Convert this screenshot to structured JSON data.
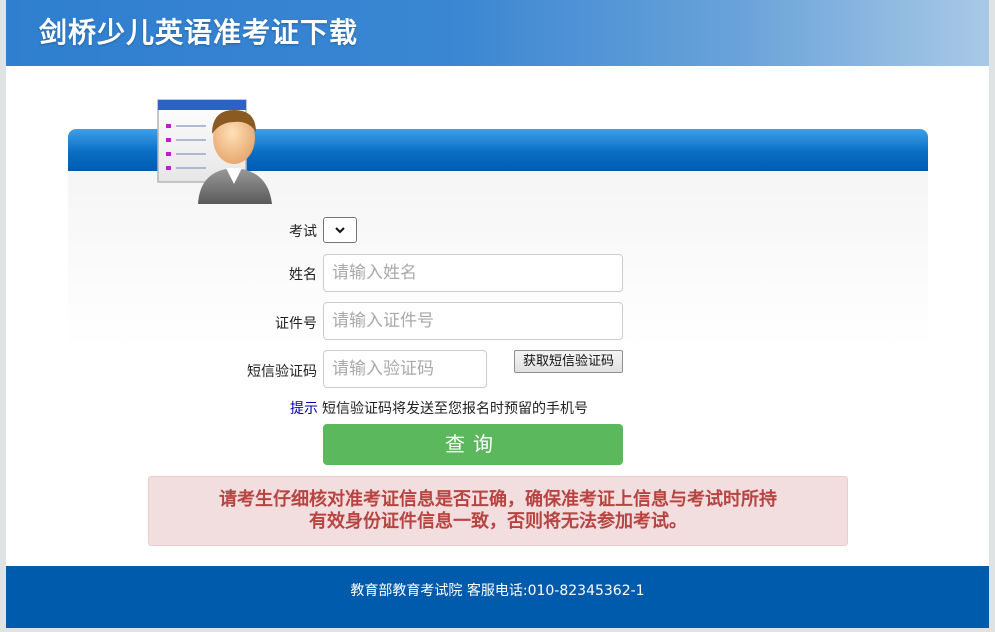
{
  "header": {
    "title": "剑桥少儿英语准考证下载"
  },
  "form": {
    "exam_label": "考试",
    "name_label": "姓名",
    "name_placeholder": "请输入姓名",
    "id_label": "证件号",
    "id_placeholder": "请输入证件号",
    "sms_label": "短信验证码",
    "sms_placeholder": "请输入验证码",
    "sms_button": "获取短信验证码",
    "hint_link": "提示",
    "hint_text": "短信验证码将发送至您报名时预留的手机号",
    "query_button": "查询"
  },
  "notice": {
    "line1": "请考生仔细核对准考证信息是否正确，确保准考证上信息与考试时所持",
    "line2": "有效身份证件信息一致，否则将无法参加考试。"
  },
  "footer": {
    "text": "教育部教育考试院  客服电话:010-82345362-1"
  },
  "colors": {
    "header": "#2f7fd0",
    "panel_bar": "#0a6fc4",
    "query_button": "#5cb85c",
    "notice_bg": "#f2dede",
    "notice_text": "#b84442",
    "footer": "#005bac"
  }
}
